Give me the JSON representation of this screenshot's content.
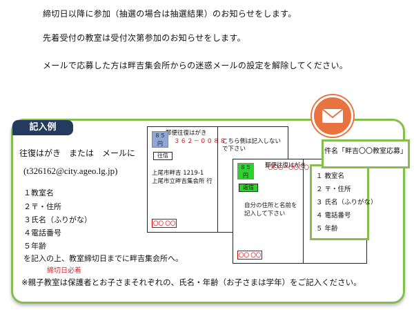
{
  "notices": [
    "締切日以降に参加（抽選の場合は抽選結果）のお知らせをします。",
    "先着受付の教室は受付次第参加のお知らせをします。",
    "メールで応募した方は畔吉集会所からの迷惑メールの設定を解除してください。"
  ],
  "example": {
    "badge": "記入例",
    "main_line": "往復はがき　または　メールに",
    "email": "(t326162@city.ageo.lg.jp)",
    "items": [
      "１教室名",
      "２〒・住所",
      "３氏名（ふりがな）",
      "４電話番号",
      "５年齢"
    ],
    "after": "を記入の上、教室締切日までに畔吉集会所へ。",
    "deadline_note": "締切日必着",
    "footnote": "※親子教室は保護者とお子さまそれぞれの、氏名・年齢（お子さまは学年）をご記入ください。"
  },
  "postcard_back": {
    "header": "郵便往復はがき",
    "stamp": "８５円",
    "tag": "往信",
    "zip": "３６２－００８８",
    "address1": "上尾市畔吉 1219-1",
    "address2": "上尾市立畔吉集会所 行",
    "note": "こちら側は記入しないで下さい",
    "bottom_box": "〇〇 〇〇"
  },
  "postcard_front": {
    "header": "郵便往復はがき",
    "stamp": "８５円",
    "tag": "返信",
    "zip": "〇〇〇－〇〇〇〇",
    "instruction1": "自分の住所と名前を",
    "instruction2": "記入して下さい",
    "bottom_box": "〇〇 〇〇"
  },
  "email_panel": {
    "subject": "件名「畔吉〇〇教室応募」",
    "items": [
      "１ 教室名",
      "２ 〒・住所",
      "３ 氏名（ふりがな）",
      "４ 電話番号",
      "５ 年齢"
    ]
  },
  "colors": {
    "panel_border": "#86be4e",
    "badge_bg": "#243a5e",
    "mail_icon": "#e8733e",
    "stamp_blue": "#8fa7d8",
    "stamp_green": "#2ed12e",
    "red": "#cc0000"
  }
}
